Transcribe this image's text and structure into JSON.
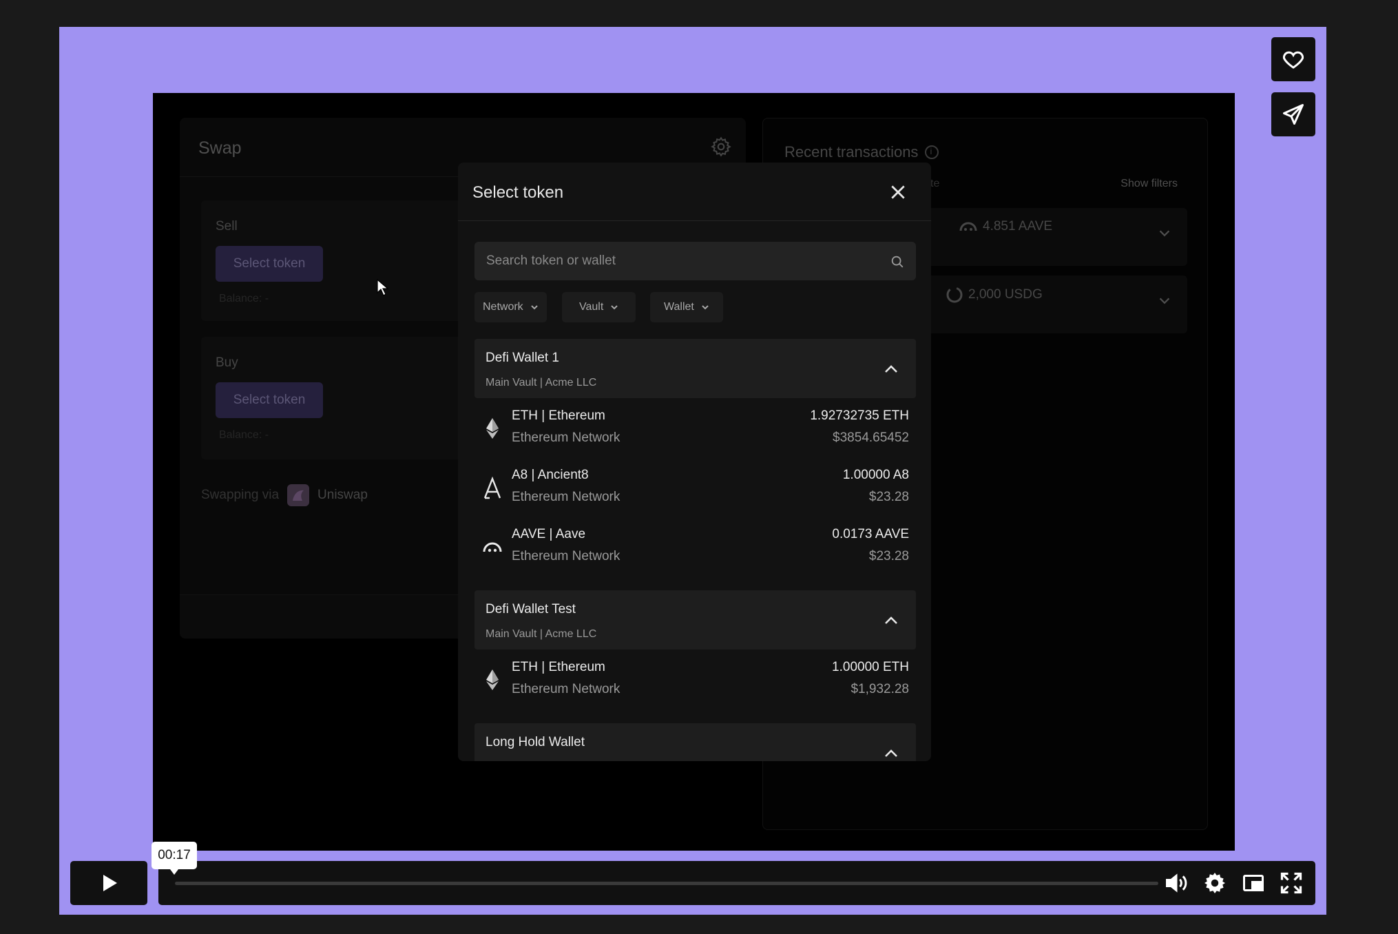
{
  "swap": {
    "title": "Swap",
    "sell": {
      "label": "Sell",
      "button": "Select token",
      "balance": "Balance: -"
    },
    "buy": {
      "label": "Buy",
      "button": "Select token",
      "balance": "Balance: -"
    },
    "swapping_via": "Swapping via",
    "provider": "Uniswap"
  },
  "recent": {
    "title": "Recent transactions",
    "column_fragment": "te",
    "show_filters": "Show filters",
    "rows": [
      {
        "amount": "4.851 AAVE",
        "icon": "aave-icon"
      },
      {
        "amount": "2,000 USDG",
        "icon": "usdg-icon"
      }
    ]
  },
  "modal": {
    "title": "Select token",
    "search_placeholder": "Search token or wallet",
    "filters": [
      "Network",
      "Vault",
      "Wallet"
    ],
    "groups": [
      {
        "name": "Defi Wallet 1",
        "sub": "Main Vault | Acme LLC",
        "tokens": [
          {
            "icon": "ethereum-icon",
            "name": "ETH | Ethereum",
            "network": "Ethereum Network",
            "amount": "1.92732735 ETH",
            "usd": "$3854.65452"
          },
          {
            "icon": "ancient8-icon",
            "name": "A8 | Ancient8",
            "network": "Ethereum Network",
            "amount": "1.00000 A8",
            "usd": "$23.28"
          },
          {
            "icon": "aave-icon",
            "name": "AAVE | Aave",
            "network": "Ethereum Network",
            "amount": "0.0173 AAVE",
            "usd": "$23.28"
          }
        ]
      },
      {
        "name": "Defi Wallet Test",
        "sub": "Main Vault | Acme LLC",
        "tokens": [
          {
            "icon": "ethereum-icon",
            "name": "ETH | Ethereum",
            "network": "Ethereum Network",
            "amount": "1.00000 ETH",
            "usd": "$1,932.28"
          }
        ]
      },
      {
        "name": "Long Hold Wallet",
        "sub": "",
        "tokens": []
      }
    ]
  },
  "player": {
    "time": "00:17",
    "progress": 0.0,
    "icons": [
      "play-icon",
      "volume-icon",
      "settings-icon",
      "pip-icon",
      "fullscreen-icon",
      "heart-icon",
      "share-icon"
    ]
  },
  "colors": {
    "stage_background": "#a092f2",
    "accent_button": "#3a325e"
  }
}
